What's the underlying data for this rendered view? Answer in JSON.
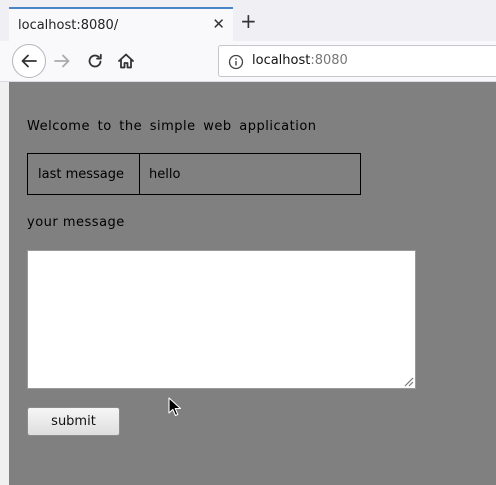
{
  "browser": {
    "tab": {
      "title": "localhost:8080/",
      "close_icon": "close-icon"
    },
    "new_tab_icon": "plus-icon",
    "nav": {
      "back_icon": "back-arrow-icon",
      "forward_icon": "forward-arrow-icon",
      "reload_icon": "reload-icon",
      "home_icon": "home-icon"
    },
    "url": {
      "host": "localhost",
      "port": ":8080",
      "info_icon": "info-icon"
    }
  },
  "page": {
    "background_color": "#808080",
    "welcome_text": "Welcome to the simple web application",
    "last_message": {
      "label": "last message",
      "value": "hello"
    },
    "your_message_label": "your message",
    "textarea": {
      "value": "",
      "placeholder": ""
    },
    "submit_label": "submit"
  }
}
